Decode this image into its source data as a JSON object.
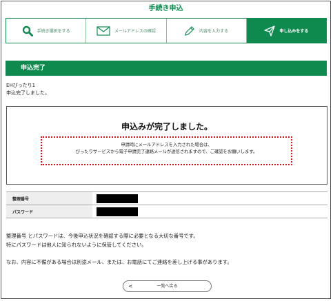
{
  "page_title": "手続き申込",
  "steps": [
    {
      "label": "手続き選択をする",
      "icon": "search-icon",
      "active": false
    },
    {
      "label": "メールアドレスの確認",
      "icon": "envelope-icon",
      "active": false
    },
    {
      "label": "内容を入力する",
      "icon": "pencil-icon",
      "active": false
    },
    {
      "label": "申し込みをする",
      "icon": "send-icon",
      "active": true
    }
  ],
  "section_title": "申込完了",
  "intro": {
    "line1": "EHぴったり1",
    "line2": "申込完了しました。"
  },
  "completion": {
    "heading": "申込みが完了しました。",
    "notice_line1": "申請時にメールアドレスを入力された場合は、",
    "notice_line2": "ぴったりサービスから電子申請完了連絡メールが送信されますので、ご確認をお願いします。"
  },
  "info_rows": [
    {
      "label": "整理番号",
      "value_redacted": true
    },
    {
      "label": "パスワード",
      "value_redacted": true
    }
  ],
  "notes": {
    "line1": "整理番号 とパスワードは、今後申込状況を確認する際に必要となる大切な番号です。",
    "line2": "特にパスワードは他人に知られないように保管してください。",
    "line3": "なお、内容に不備がある場合は別途メール、または、お電話にてご連絡を差し上げる事があります。"
  },
  "back_button": {
    "label": "一覧へ戻る",
    "chevron": "<"
  },
  "colors": {
    "brand_green": "#0e8a4f",
    "notice_border": "#dd1111"
  }
}
